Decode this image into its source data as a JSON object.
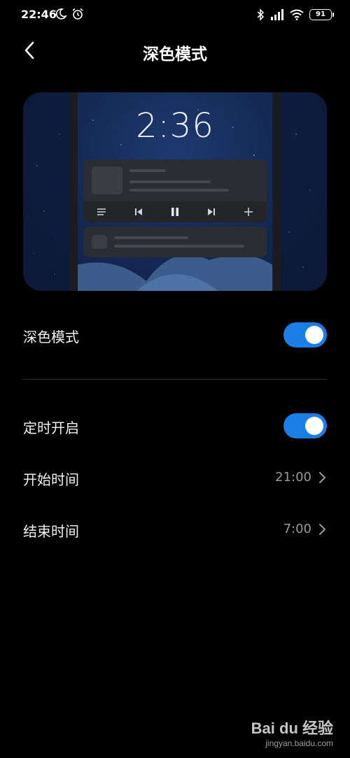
{
  "status_bar": {
    "time": "22:46",
    "battery": "91",
    "icons": [
      "moon-icon",
      "alarm-icon",
      "bluetooth-icon",
      "signal-icon",
      "wifi-icon",
      "battery-icon"
    ]
  },
  "header": {
    "title": "深色模式",
    "back_icon": "back-arrow-icon"
  },
  "preview": {
    "clock": "2:36",
    "media_controls": [
      "list-icon",
      "previous-icon",
      "pause-icon",
      "next-icon",
      "add-icon"
    ]
  },
  "settings": {
    "dark_mode": {
      "label": "深色模式",
      "enabled": true
    },
    "schedule": {
      "label": "定时开启",
      "enabled": true
    },
    "start_time": {
      "label": "开始时间",
      "value": "21:00"
    },
    "end_time": {
      "label": "结束时间",
      "value": "7:00"
    }
  },
  "colors": {
    "background": "#000000",
    "accent": "#1a7ee6",
    "text_primary": "#f2f2f2",
    "text_secondary": "#9a9a9a"
  },
  "watermark": {
    "logo": "Bai du 经验",
    "url": "jingyan.baidu.com"
  }
}
